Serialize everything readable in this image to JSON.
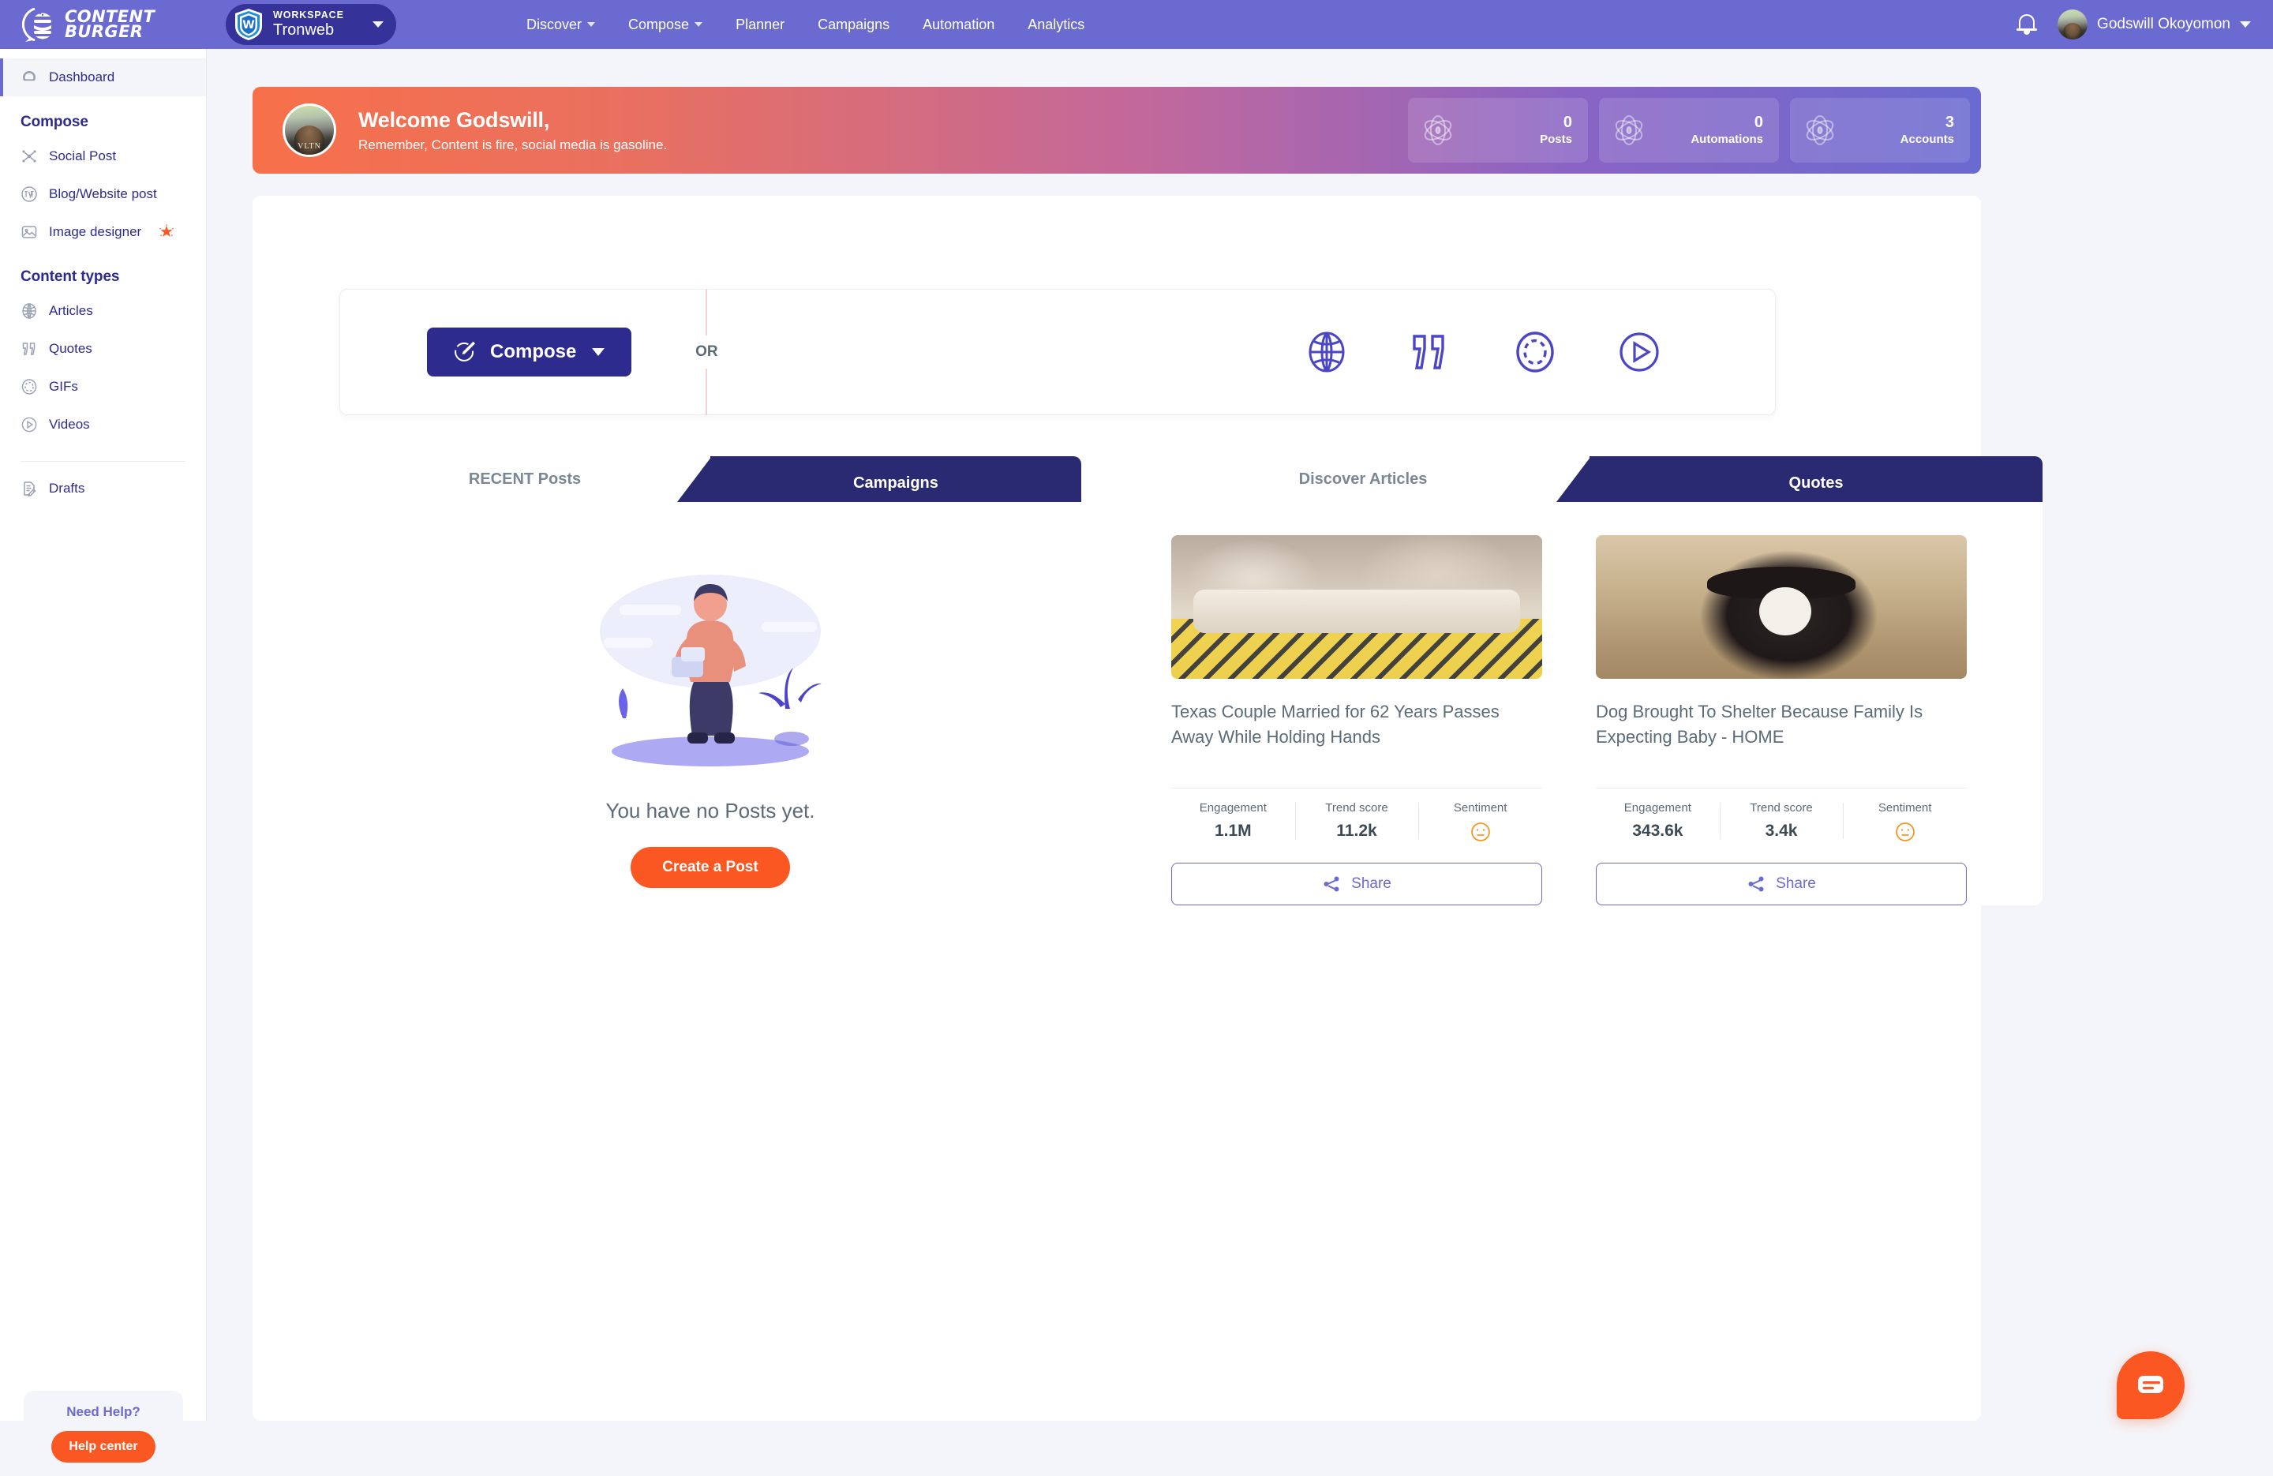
{
  "brand": {
    "line1": "CONTENT",
    "line2": "BURGER",
    "logo_icon": "burger-logo-icon"
  },
  "workspace": {
    "kicker": "WORKSPACE",
    "name": "Tronweb",
    "logo_icon": "tronweb-shield-icon",
    "caret_icon": "chevron-down-icon"
  },
  "nav": [
    {
      "label": "Discover",
      "has_dropdown": true
    },
    {
      "label": "Compose",
      "has_dropdown": true
    },
    {
      "label": "Planner",
      "has_dropdown": false
    },
    {
      "label": "Campaigns",
      "has_dropdown": false
    },
    {
      "label": "Automation",
      "has_dropdown": false
    },
    {
      "label": "Analytics",
      "has_dropdown": false
    }
  ],
  "topbar_right": {
    "bell_icon": "notification-bell-icon",
    "user_name": "Godswill Okoyomon",
    "avatar_icon": "user-avatar",
    "caret_icon": "chevron-down-icon"
  },
  "sidebar": {
    "dashboard": {
      "label": "Dashboard",
      "icon": "dashboard-gauge-icon",
      "active": true
    },
    "compose_heading": "Compose",
    "compose_items": [
      {
        "label": "Social Post",
        "icon": "share-network-icon"
      },
      {
        "label": "Blog/Website post",
        "icon": "wordpress-icon"
      },
      {
        "label": "Image designer",
        "icon": "image-picture-icon",
        "badge_icon": "sparkle-star-icon"
      }
    ],
    "content_heading": "Content types",
    "content_items": [
      {
        "label": "Articles",
        "icon": "globe-icon"
      },
      {
        "label": "Quotes",
        "icon": "quote-marks-icon"
      },
      {
        "label": "GIFs",
        "icon": "dashed-circle-icon"
      },
      {
        "label": "Videos",
        "icon": "play-circle-icon"
      }
    ],
    "drafts": {
      "label": "Drafts",
      "icon": "document-pencil-icon"
    },
    "help": {
      "title": "Need Help?",
      "button": "Help center"
    }
  },
  "welcome": {
    "greeting": "Welcome Godswill,",
    "tagline": "Remember, Content is fire, social media is gasoline.",
    "avatar_caption": "VLTN",
    "stats": [
      {
        "value": "0",
        "label": "Posts",
        "icon": "atom-orbit-icon"
      },
      {
        "value": "0",
        "label": "Automations",
        "icon": "atom-orbit-icon"
      },
      {
        "value": "3",
        "label": "Accounts",
        "icon": "atom-orbit-icon"
      }
    ]
  },
  "compose_bar": {
    "button_label": "Compose",
    "button_icon": "pencil-circle-icon",
    "caret_icon": "caret-down-icon",
    "divider_label": "OR",
    "quick_actions": [
      {
        "name": "articles",
        "icon": "globe-icon"
      },
      {
        "name": "quotes",
        "icon": "quote-marks-icon"
      },
      {
        "name": "gifs",
        "icon": "dashed-circle-icon"
      },
      {
        "name": "videos",
        "icon": "play-circle-icon"
      }
    ]
  },
  "left_panel": {
    "tabs": [
      {
        "label": "RECENT Posts",
        "active": true
      },
      {
        "label": "Campaigns",
        "active": false
      }
    ],
    "empty_message": "You have no Posts yet.",
    "empty_cta": "Create a Post"
  },
  "right_panel": {
    "tabs": [
      {
        "label": "Discover Articles",
        "active": true
      },
      {
        "label": "Quotes",
        "active": false
      }
    ],
    "metric_labels": {
      "engagement": "Engagement",
      "trend": "Trend score",
      "sentiment": "Sentiment"
    },
    "share_label": "Share",
    "share_icon": "share-node-icon",
    "sentiment_icon": "neutral-face-icon",
    "articles": [
      {
        "title": "Texas Couple Married for 62 Years Passes Away While Holding Hands",
        "engagement": "1.1M",
        "trend_score": "11.2k",
        "thumb": "elderly-couple-in-bed-photo"
      },
      {
        "title": "Dog Brought To Shelter Because Family Is Expecting Baby - HOME",
        "engagement": "343.6k",
        "trend_score": "3.4k",
        "thumb": "black-and-white-dog-photo"
      }
    ]
  },
  "chat_widget": {
    "icon": "chat-bubble-icon"
  },
  "colors": {
    "topbar": "#6a6ad0",
    "workspace_pill": "#35339a",
    "primary": "#2e2b8f",
    "tab_active": "#2a2a72",
    "accent_orange": "#fa5723",
    "page_bg": "#f4f5fa"
  }
}
